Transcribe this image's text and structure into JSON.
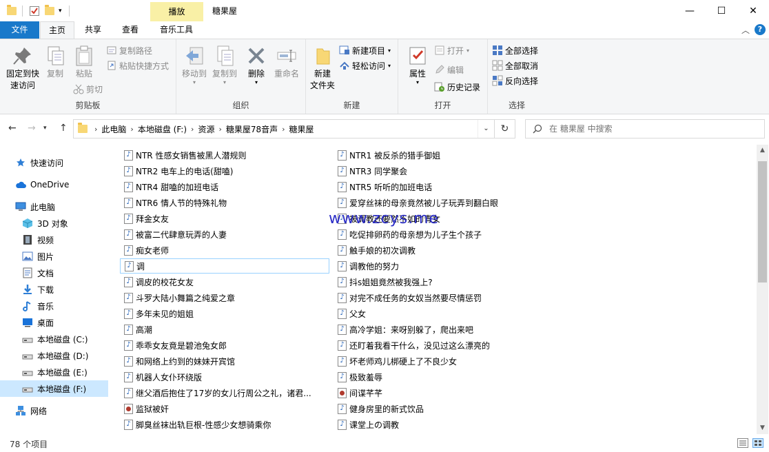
{
  "window": {
    "title": "糖果屋",
    "context_tab": "播放",
    "minimize": "—",
    "maximize": "☐",
    "close": "✕"
  },
  "tabs": {
    "file": "文件",
    "home": "主页",
    "share": "共享",
    "view": "查看",
    "music_tools": "音乐工具",
    "help": "?"
  },
  "ribbon": {
    "clipboard": {
      "label": "剪贴板",
      "pin": "固定到快\n速访问",
      "pin_line1": "固定到快",
      "pin_line2": "速访问",
      "copy": "复制",
      "paste": "粘贴",
      "copy_path": "复制路径",
      "paste_shortcut": "粘贴快捷方式",
      "cut": "剪切"
    },
    "organize": {
      "label": "组织",
      "move_to": "移动到",
      "copy_to": "复制到",
      "delete": "删除",
      "rename": "重命名"
    },
    "new": {
      "label": "新建",
      "new_folder_line1": "新建",
      "new_folder_line2": "文件夹",
      "new_item": "新建项目",
      "easy_access": "轻松访问"
    },
    "open": {
      "label": "打开",
      "properties": "属性",
      "open": "打开",
      "edit": "编辑",
      "history": "历史记录"
    },
    "select": {
      "label": "选择",
      "select_all": "全部选择",
      "select_none": "全部取消",
      "invert": "反向选择"
    }
  },
  "address": {
    "crumbs": [
      "此电脑",
      "本地磁盘 (F:)",
      "资源",
      "糖果屋78音声",
      "糖果屋"
    ],
    "search_placeholder": "在 糖果屋 中搜索"
  },
  "nav": {
    "items": [
      {
        "label": "快速访问",
        "icon": "star-icon"
      },
      {
        "label": "OneDrive",
        "icon": "cloud-icon"
      },
      {
        "label": "此电脑",
        "icon": "pc-icon"
      },
      {
        "label": "3D 对象",
        "icon": "cube-icon"
      },
      {
        "label": "视频",
        "icon": "film-icon"
      },
      {
        "label": "图片",
        "icon": "picture-icon"
      },
      {
        "label": "文档",
        "icon": "document-icon"
      },
      {
        "label": "下载",
        "icon": "download-icon"
      },
      {
        "label": "音乐",
        "icon": "music-icon"
      },
      {
        "label": "桌面",
        "icon": "desktop-icon"
      },
      {
        "label": "本地磁盘 (C:)",
        "icon": "drive-icon"
      },
      {
        "label": "本地磁盘 (D:)",
        "icon": "drive-icon"
      },
      {
        "label": "本地磁盘 (E:)",
        "icon": "drive-icon"
      },
      {
        "label": "本地磁盘 (F:)",
        "icon": "drive-icon"
      },
      {
        "label": "网络",
        "icon": "network-icon"
      }
    ]
  },
  "files": {
    "col1": [
      {
        "name": "NTR 性感女销售被黑人潜规则",
        "type": "audio"
      },
      {
        "name": "NTR2 电车上的电话(甜嗑)",
        "type": "audio"
      },
      {
        "name": "NTR4 甜嗑的加班电话",
        "type": "audio"
      },
      {
        "name": "NTR6 情人节的特殊礼物",
        "type": "audio"
      },
      {
        "name": "拜金女友",
        "type": "audio"
      },
      {
        "name": "被富二代肆意玩弄的人妻",
        "type": "audio"
      },
      {
        "name": "痴女老师",
        "type": "audio"
      },
      {
        "name": "调",
        "type": "audio"
      },
      {
        "name": "调皮的校花女友",
        "type": "audio"
      },
      {
        "name": "斗罗大陆小舞篇之纯爱之章",
        "type": "audio"
      },
      {
        "name": "多年未见的姐姐",
        "type": "audio"
      },
      {
        "name": "高潮",
        "type": "audio"
      },
      {
        "name": "乖乖女友竟是碧池兔女郎",
        "type": "audio"
      },
      {
        "name": "和网络上约到的妹妹开宾馆",
        "type": "audio"
      },
      {
        "name": "机器人女仆环绕版",
        "type": "audio"
      },
      {
        "name": "继父酒后抱住了17岁的女儿行周公之礼，诸君...",
        "type": "audio"
      },
      {
        "name": "监狱被奸",
        "type": "video"
      },
      {
        "name": "脚臭丝袜出轨巨根-性感少女想骑乘你",
        "type": "audio"
      }
    ],
    "col2": [
      {
        "name": "NTR1 被反杀的猎手御姐",
        "type": "audio"
      },
      {
        "name": "NTR3 同学聚会",
        "type": "audio"
      },
      {
        "name": "NTR5 听听的加班电话",
        "type": "audio"
      },
      {
        "name": "爱穿丝袜的母亲竟然被儿子玩弄到翻白眼",
        "type": "audio"
      },
      {
        "name": "被调教还要然不如的青女",
        "type": "audio"
      },
      {
        "name": "吃促排卵药的母亲想为儿子生个孩子",
        "type": "audio"
      },
      {
        "name": "触手娘的初次调教",
        "type": "audio"
      },
      {
        "name": "调教他的努力",
        "type": "audio"
      },
      {
        "name": "抖s姐姐竟然被我强上?",
        "type": "audio"
      },
      {
        "name": "对完不成任务的女奴当然要尽情惩罚",
        "type": "audio"
      },
      {
        "name": "父女",
        "type": "audio"
      },
      {
        "name": "高冷学姐：来呀别躲了，爬出来吧",
        "type": "audio"
      },
      {
        "name": "还盯着我看干什么，没见过这么漂亮的",
        "type": "audio"
      },
      {
        "name": "坏老师鸡儿梆硬上了不良少女",
        "type": "audio"
      },
      {
        "name": "极致羞辱",
        "type": "audio"
      },
      {
        "name": "间谍芊芊",
        "type": "video"
      },
      {
        "name": "健身房里的新式饮品",
        "type": "audio"
      },
      {
        "name": "课堂上の调教",
        "type": "audio"
      }
    ]
  },
  "watermark": "www.zcys.me",
  "status": {
    "count": "78 个项目"
  },
  "colors": {
    "accent": "#1979ca",
    "selection": "#cce8ff",
    "context_tab": "#f9f0a6"
  }
}
